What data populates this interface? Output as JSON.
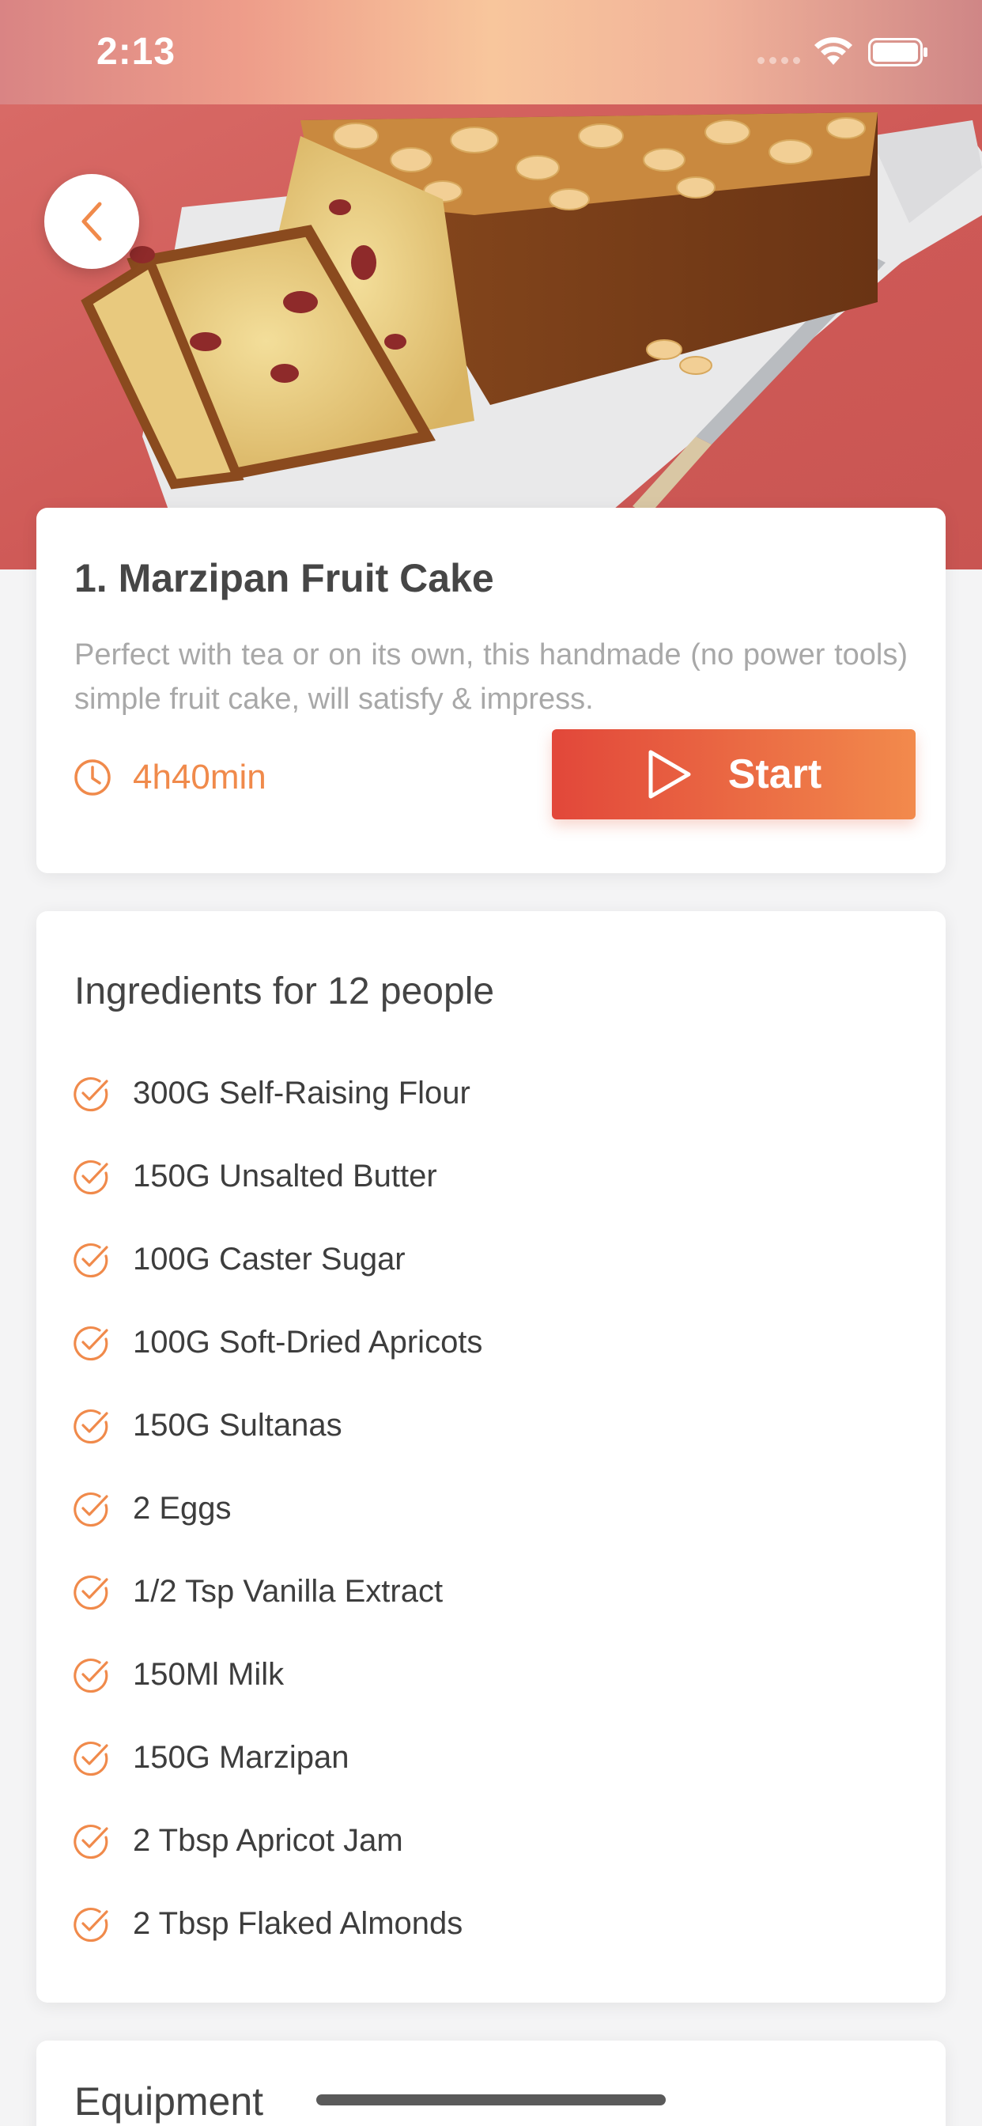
{
  "status_bar": {
    "time": "2:13"
  },
  "recipe": {
    "title": "1. Marzipan Fruit Cake",
    "description": "Perfect with tea or on its own, this handmade (no power tools) simple fruit cake, will satisfy & impress.",
    "duration": "4h40min",
    "start_label": "Start"
  },
  "ingredients": {
    "title": "Ingredients for 12 people",
    "items": [
      "300G Self-Raising Flour",
      "150G Unsalted Butter",
      "100G Caster Sugar",
      "100G Soft-Dried Apricots",
      "150G Sultanas",
      "2 Eggs",
      "1/2 Tsp Vanilla Extract",
      "150Ml Milk",
      "150G Marzipan",
      "2 Tbsp Apricot Jam",
      "2 Tbsp Flaked Almonds"
    ]
  },
  "equipment": {
    "title": "Equipment"
  },
  "colors": {
    "accent": "#f08a4b",
    "button_start": "#e2473a",
    "button_end": "#f28a4c",
    "background": "#f4f4f5"
  },
  "icons": {
    "back": "chevron-left-icon",
    "clock": "clock-icon",
    "play": "play-icon",
    "check": "check-circle-icon",
    "wifi": "wifi-icon",
    "battery": "battery-icon"
  }
}
